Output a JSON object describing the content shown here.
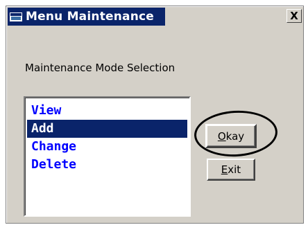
{
  "window": {
    "title": "Menu Maintenance",
    "close_glyph": "X",
    "icon": "window-icon"
  },
  "dialog": {
    "selection_label": "Maintenance Mode Selection"
  },
  "list": {
    "items": [
      {
        "label": "View",
        "selected": false
      },
      {
        "label": "Add",
        "selected": true
      },
      {
        "label": "Change",
        "selected": false
      },
      {
        "label": "Delete",
        "selected": false
      }
    ]
  },
  "buttons": {
    "okay": {
      "mnemonic": "O",
      "rest": "kay"
    },
    "exit": {
      "mnemonic": "E",
      "rest": "xit"
    }
  },
  "colors": {
    "title_bar": "#0a246a",
    "list_text": "#0000ff",
    "selection": "#0a246a",
    "dialog_bg": "#d4d0c8"
  }
}
